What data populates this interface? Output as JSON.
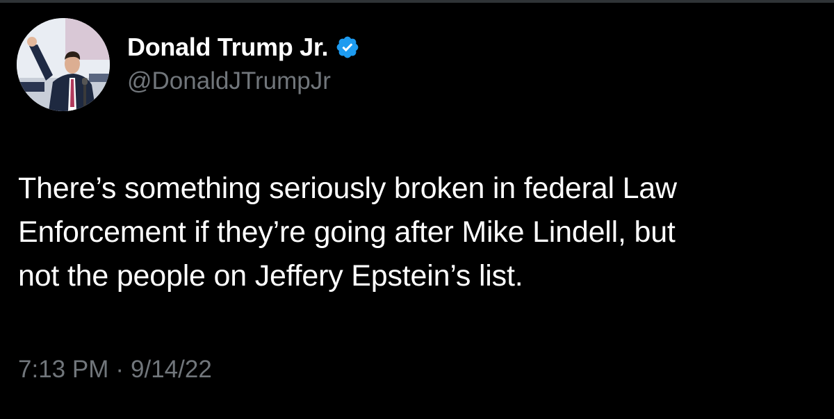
{
  "author": {
    "display_name": "Donald Trump Jr.",
    "handle": "@DonaldJTrumpJr",
    "verified": true,
    "avatar_icon": "profile-photo"
  },
  "tweet": {
    "text": "There’s something seriously broken in federal Law\nEnforcement if they’re going after Mike Lindell, but\nnot the people on Jeffery Epstein’s list.",
    "time": "7:13 PM",
    "separator": "·",
    "date": "9/14/22"
  },
  "colors": {
    "background": "#000000",
    "primary_text": "#ffffff",
    "secondary_text": "#71767b",
    "verified_blue": "#1d9bf0"
  }
}
